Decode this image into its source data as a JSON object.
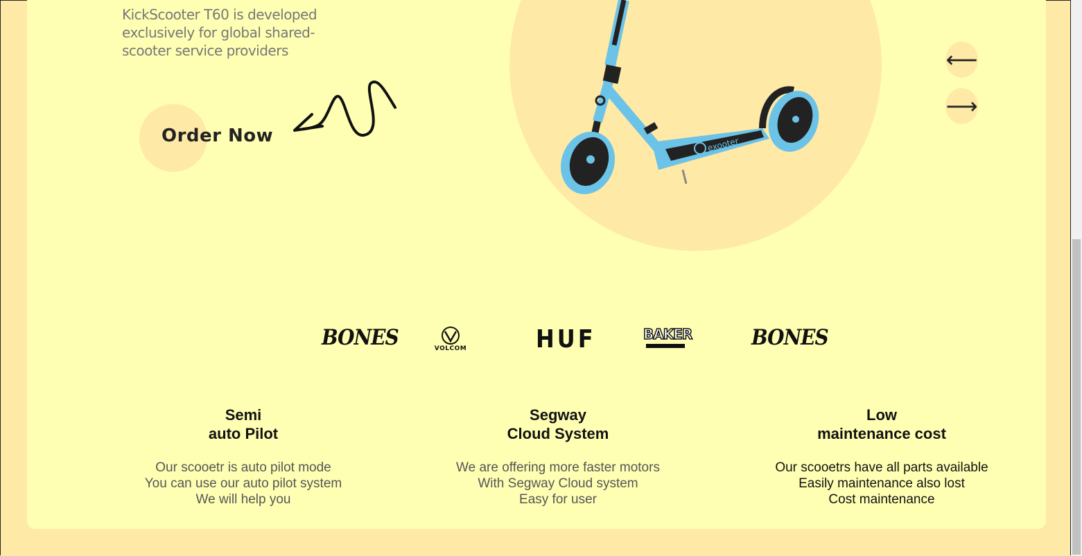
{
  "hero": {
    "description": "KickScooter T60 is developed exclusively for global shared-scooter service providers",
    "order_label": "Order Now",
    "prev_label": "⟵",
    "next_label": "⟶"
  },
  "brands": [
    "BONES",
    "VOLCOM",
    "HUF",
    "BAKER",
    "BONES"
  ],
  "features": [
    {
      "title_line1": "Semi",
      "title_line2": "auto Pilot",
      "desc_line1": "Our scooetr is auto pilot mode",
      "desc_line2": "You can use our auto pilot system",
      "desc_line3": "We will help you"
    },
    {
      "title_line1": "Segway",
      "title_line2": "Cloud System",
      "desc_line1": "We are offering more faster motors",
      "desc_line2": "With Segway Cloud system",
      "desc_line3": "Easy for user"
    },
    {
      "title_line1": "Low",
      "title_line2": "maintenance cost",
      "desc_line1": "Our scooetrs have all parts available",
      "desc_line2": "Easily maintenance also lost",
      "desc_line3": "Cost maintenance"
    }
  ],
  "scooter_brand": "exooter",
  "colors": {
    "page_bg": "#ffe9a6",
    "card_bg": "#ffffb3",
    "accent": "#ffe9a6",
    "scooter_blue": "#6cc3e8"
  }
}
